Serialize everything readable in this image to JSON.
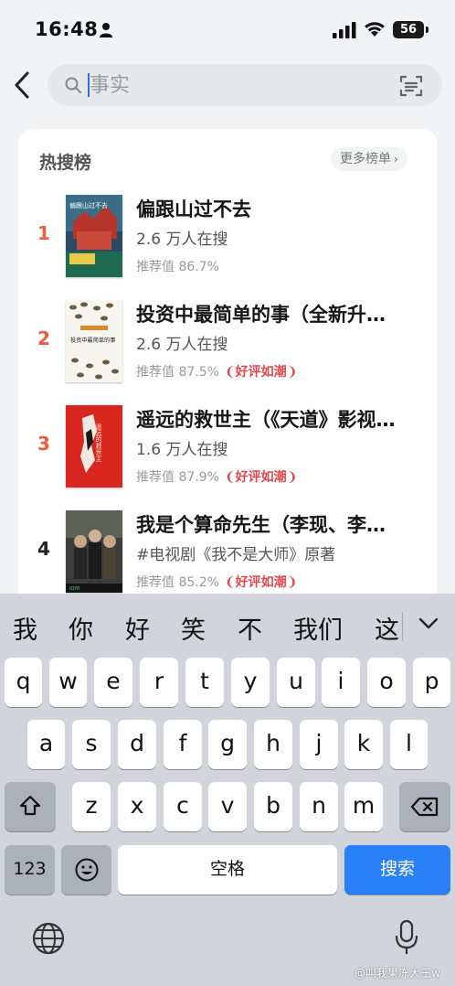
{
  "status": {
    "time": "16:48",
    "battery": "56"
  },
  "search": {
    "placeholder": "事实"
  },
  "hot": {
    "title": "热搜榜",
    "more_label": "更多榜单",
    "items": [
      {
        "rank": "1",
        "rank_color": "#ef5a3a",
        "name": "偏跟山过不去",
        "sub": "2.6 万人在搜",
        "rec": "推荐值 86.7%",
        "badge": ""
      },
      {
        "rank": "2",
        "rank_color": "#ef5a3a",
        "name": "投资中最简单的事（全新升…",
        "sub": "2.6 万人在搜",
        "rec": "推荐值 87.5%",
        "badge": "好评如潮"
      },
      {
        "rank": "3",
        "rank_color": "#ef5a3a",
        "name": "遥远的救世主（《天道》影视…",
        "sub": "1.6 万人在搜",
        "rec": "推荐值 87.9%",
        "badge": "好评如潮"
      },
      {
        "rank": "4",
        "rank_color": "#222222",
        "name": "我是个算命先生（李现、李…",
        "sub": "#电视剧《我不是大师》原著",
        "rec": "推荐值 85.2%",
        "badge": "好评如潮"
      }
    ],
    "covers": [
      {
        "cover_text": "偏跟山过不去"
      },
      {
        "cover_text": "投资中最简单的事"
      },
      {
        "cover_text": "遥远的救世主"
      },
      {
        "cover_text": "iQIYI"
      }
    ]
  },
  "keyboard": {
    "candidates": [
      "我",
      "你",
      "好",
      "笑",
      "不",
      "我们",
      "这"
    ],
    "row1": [
      "q",
      "w",
      "e",
      "r",
      "t",
      "y",
      "u",
      "i",
      "o",
      "p"
    ],
    "row2": [
      "a",
      "s",
      "d",
      "f",
      "g",
      "h",
      "j",
      "k",
      "l"
    ],
    "row3": [
      "z",
      "x",
      "c",
      "v",
      "b",
      "n",
      "m"
    ],
    "num_label": "123",
    "space_label": "空格",
    "search_label": "搜索"
  },
  "watermark": "@叫我果冻大王w",
  "colors": {
    "accent": "#2a80f6",
    "badge": "#e2474c",
    "rank_red": "#ef5a3a"
  }
}
